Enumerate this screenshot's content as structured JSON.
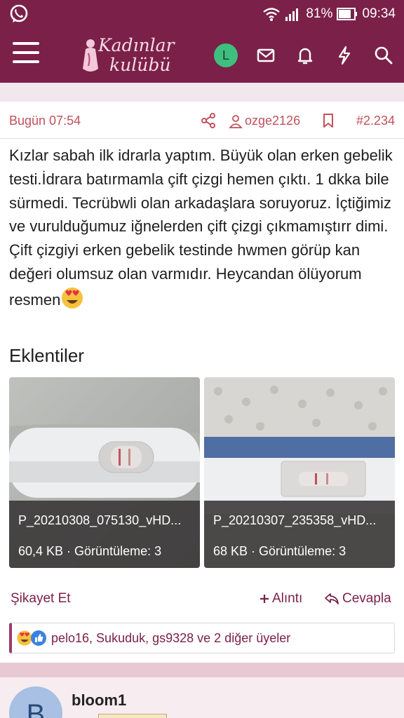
{
  "status": {
    "battery": "81%",
    "time": "09:34"
  },
  "appbar": {
    "logo_line1": "Kadınlar",
    "logo_line2": "kulübü",
    "user_initial": "L"
  },
  "post": {
    "time": "Bugün 07:54",
    "author": "ozge2126",
    "number": "#2.234",
    "body": "Kızlar sabah ilk idrarla yaptım. Büyük olan erken gebelik testi.İdrara batırmamla çift çizgi hemen çıktı. 1 dkka bile sürmedi. Tecrübwli olan arkadaşlara soruyoruz. İçtiğimiz ve vurulduğumuz iğnelerden çift çizgi çıkmamıştırr dimi. Çift çizgiyi erken gebelik testinde hwmen görüp kan değeri olumsuz olan varmıdır. Heycandan ölüyorum resmen",
    "attachments_title": "Eklentiler",
    "attachments": [
      {
        "filename": "P_20210308_075130_vHD...",
        "info": "60,4 KB · Görüntüleme: 3"
      },
      {
        "filename": "P_20210307_235358_vHD...",
        "info": "68 KB · Görüntüleme: 3"
      }
    ],
    "actions": {
      "report": "Şikayet Et",
      "quote": "Alıntı",
      "reply": "Cevapla"
    },
    "reactions_text": "pelo16, Sukuduk, gs9328 ve 2 diğer üyeler"
  },
  "next_post": {
    "avatar_initial": "B",
    "author": "bloom1"
  },
  "colors": {
    "brand": "#7b2149",
    "accent": "#c0515d",
    "background": "#e8c8d3"
  }
}
